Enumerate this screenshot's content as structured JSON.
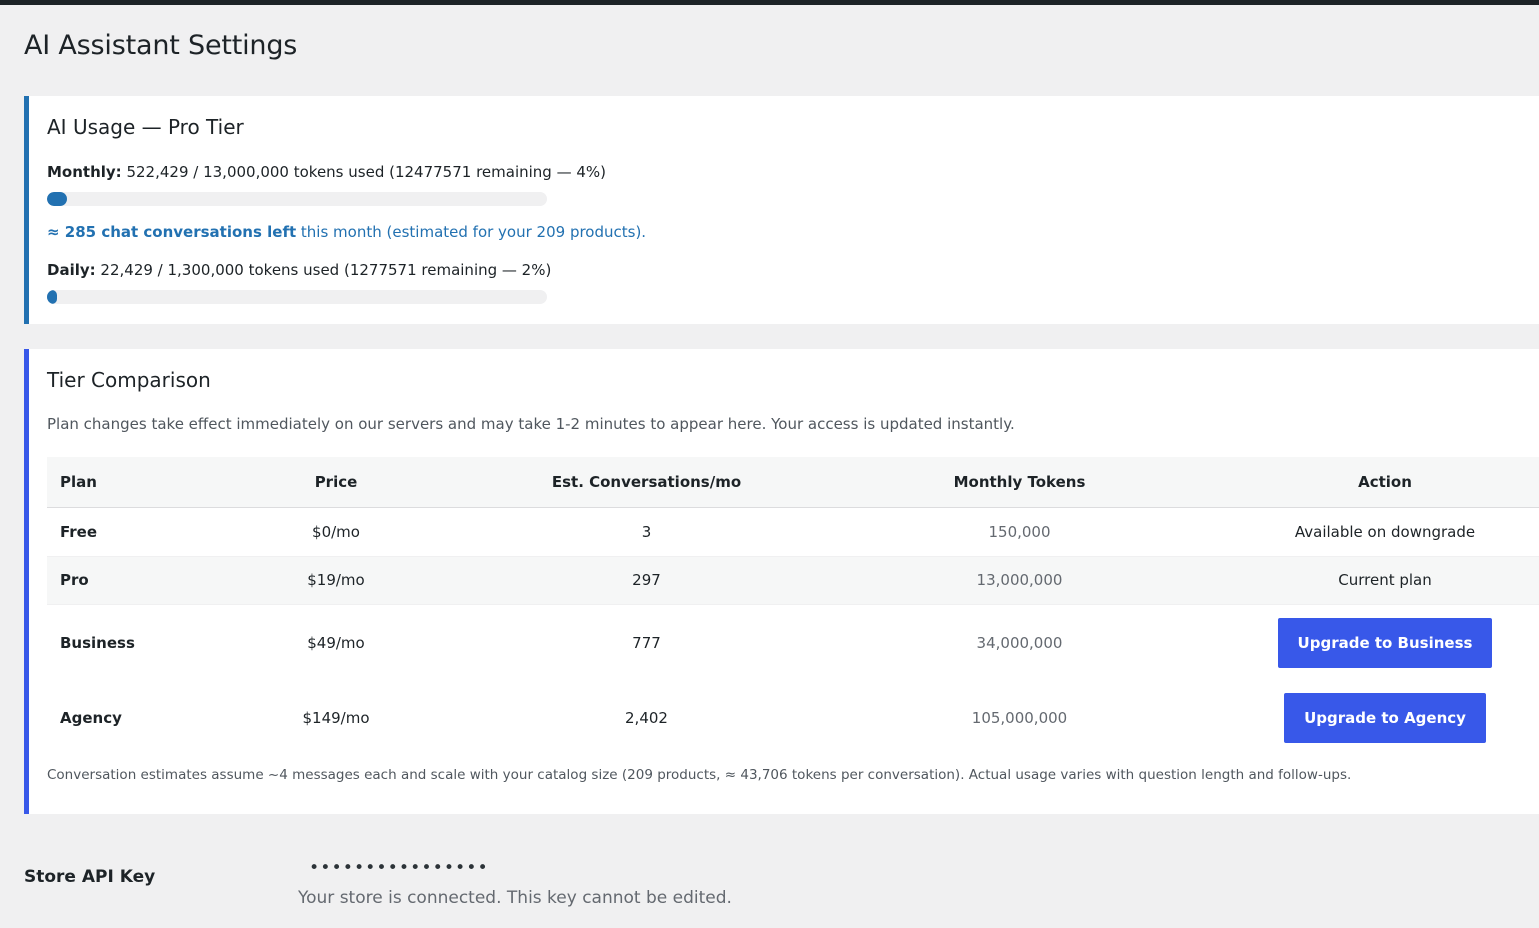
{
  "page": {
    "title": "AI Assistant Settings"
  },
  "usage": {
    "title": "AI Usage — Pro Tier",
    "monthly": {
      "label": "Monthly:",
      "text": "522,429 / 13,000,000 tokens used (12477571 remaining — 4%)",
      "used_fraction": 0.04
    },
    "conversations": {
      "bold": "≈ 285 chat conversations left",
      "rest": "this month (estimated for your 209 products)."
    },
    "daily": {
      "label": "Daily:",
      "text": "22,429 / 1,300,000 tokens used (1277571 remaining — 2%)",
      "used_fraction": 0.02
    },
    "bar_color": "#2271b1"
  },
  "tiers": {
    "title": "Tier Comparison",
    "note": "Plan changes take effect immediately on our servers and may take 1-2 minutes to appear here. Your access is updated instantly.",
    "columns": [
      "Plan",
      "Price",
      "Est. Conversations/mo",
      "Monthly Tokens",
      "Action"
    ],
    "rows": [
      {
        "plan": "Free",
        "price": "$0/mo",
        "conversations": "3",
        "tokens": "150,000",
        "action": "Available on downgrade"
      },
      {
        "plan": "Pro",
        "price": "$19/mo",
        "conversations": "297",
        "tokens": "13,000,000",
        "action": "Current plan"
      },
      {
        "plan": "Business",
        "price": "$49/mo",
        "conversations": "777",
        "tokens": "34,000,000",
        "action": "Upgrade to Business"
      },
      {
        "plan": "Agency",
        "price": "$149/mo",
        "conversations": "2,402",
        "tokens": "105,000,000",
        "action": "Upgrade to Agency"
      }
    ],
    "footnote": "Conversation estimates assume ~4 messages each and scale with your catalog size (209 products, ≈ 43,706 tokens per conversation). Actual usage varies with question length and follow-ups.",
    "accent_color": "#3858e9"
  },
  "api_key": {
    "label": "Store API Key",
    "value": "••••••••••••••••",
    "description": "Your store is connected. This key cannot be edited."
  }
}
